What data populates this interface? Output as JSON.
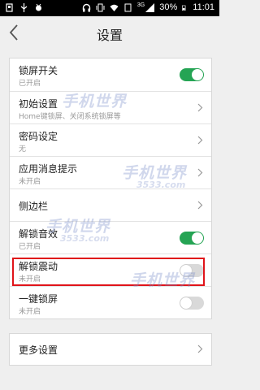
{
  "statusbar": {
    "battery": "30%",
    "time": "11:01",
    "network": "3G"
  },
  "header": {
    "title": "设置"
  },
  "settings": [
    {
      "label": "锁屏开关",
      "sub": "已开启",
      "control": "toggle",
      "on": true
    },
    {
      "label": "初始设置",
      "sub": "Home键锁屏、关闭系统锁屏等",
      "control": "chevron"
    },
    {
      "label": "密码设定",
      "sub": "无",
      "control": "chevron"
    },
    {
      "label": "应用消息提示",
      "sub": "未开启",
      "control": "chevron"
    },
    {
      "label": "侧边栏",
      "sub": "",
      "control": "chevron"
    },
    {
      "label": "解锁音效",
      "sub": "已开启",
      "control": "toggle",
      "on": true
    },
    {
      "label": "解锁震动",
      "sub": "未开启",
      "control": "toggle",
      "on": false
    },
    {
      "label": "一键锁屏",
      "sub": "未开启",
      "control": "toggle",
      "on": false
    }
  ],
  "more": {
    "label": "更多设置"
  },
  "watermark": {
    "text": "手机世界",
    "site": "3533.com"
  },
  "colors": {
    "toggle_on": "#25a454",
    "highlight": "#e0141a"
  }
}
